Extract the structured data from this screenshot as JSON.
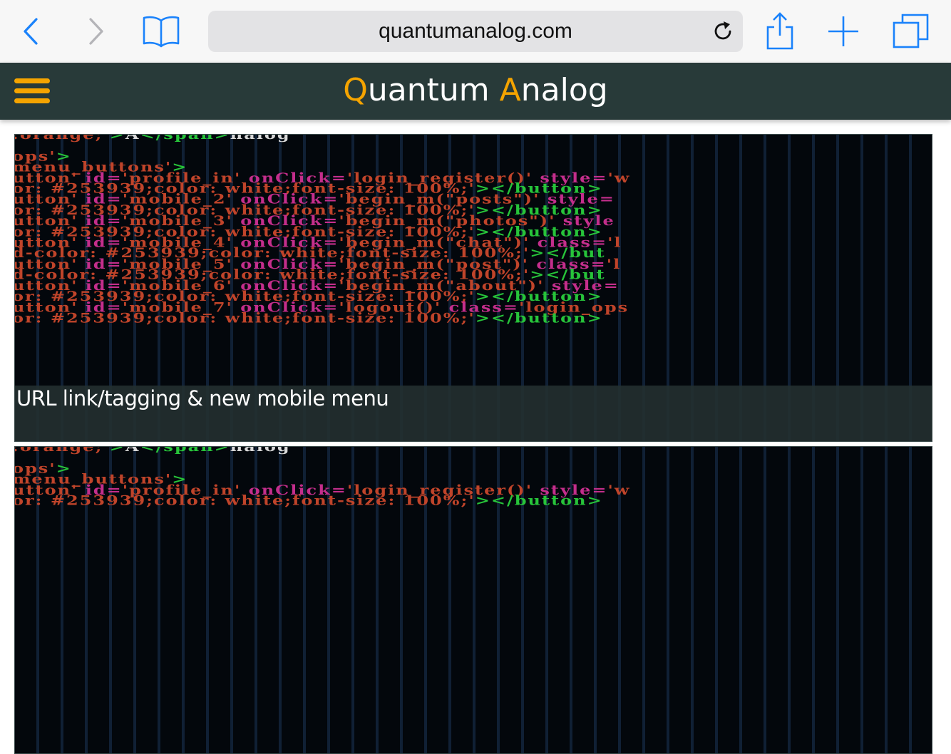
{
  "browser": {
    "url": "quantumanalog.com",
    "icons": {
      "back": "chevron-left-icon",
      "forward": "chevron-right-icon",
      "bookmarks": "book-icon",
      "reload": "reload-icon",
      "share": "share-icon",
      "new_tab": "plus-icon",
      "tabs": "tabs-icon"
    },
    "accent_color": "#1a82fb"
  },
  "site": {
    "title_q": "Q",
    "title_rest1": "uantum ",
    "title_a": "A",
    "title_rest2": "nalog",
    "header_color": "#283a39",
    "accent_color": "#f5a400",
    "menu_icon": "hamburger-icon"
  },
  "posts": [
    {
      "caption": "URL link/tagging & new mobile menu",
      "code_lines": [
        [
          [
            "red",
            ":orange;'"
          ],
          [
            "green",
            ">"
          ],
          [
            "white",
            "A"
          ],
          [
            "green",
            "</span>"
          ],
          [
            "white",
            "nalog"
          ]
        ],
        [
          [
            "red",
            ""
          ]
        ],
        [
          [
            "red",
            "ops'"
          ],
          [
            "green",
            ">"
          ]
        ],
        [
          [
            "red",
            "menu_buttons'"
          ],
          [
            "green",
            ">"
          ]
        ],
        [
          [
            "red",
            "utton' "
          ],
          [
            "pink",
            "id="
          ],
          [
            "red",
            "'profile_in' "
          ],
          [
            "pink",
            "onClick="
          ],
          [
            "red",
            "'login_register()' "
          ],
          [
            "pink",
            "style="
          ],
          [
            "red",
            "'w"
          ]
        ],
        [
          [
            "red",
            "or: #253939;color: "
          ],
          [
            "red",
            "white;font-size: 100%;'"
          ],
          [
            "green",
            "></button>"
          ]
        ],
        [
          [
            "red",
            "utton' "
          ],
          [
            "pink",
            "id="
          ],
          [
            "red",
            "'mobile_2' "
          ],
          [
            "pink",
            "onClick="
          ],
          [
            "red",
            "'begin_m(\"posts\")' "
          ],
          [
            "pink",
            "style="
          ]
        ],
        [
          [
            "red",
            "or: #253939;color: "
          ],
          [
            "red",
            "white;font-size: 100%;'"
          ],
          [
            "green",
            "></button>"
          ]
        ],
        [
          [
            "red",
            "utton' "
          ],
          [
            "pink",
            "id="
          ],
          [
            "red",
            "'mobile_3' "
          ],
          [
            "pink",
            "onClick="
          ],
          [
            "red",
            "'begin_m(\"photos\")' "
          ],
          [
            "pink",
            "style"
          ]
        ],
        [
          [
            "red",
            "or: #253939;color: "
          ],
          [
            "red",
            "white;font-size: 100%;'"
          ],
          [
            "green",
            "></button>"
          ]
        ],
        [
          [
            "red",
            "utton' "
          ],
          [
            "pink",
            "id="
          ],
          [
            "red",
            "'mobile_4' "
          ],
          [
            "pink",
            "onClick="
          ],
          [
            "red",
            "'begin_m(\"chat\")' "
          ],
          [
            "pink",
            "class="
          ],
          [
            "red",
            "'l"
          ]
        ],
        [
          [
            "red",
            "d-color: #253939;color: white;font-size: 100%;'"
          ],
          [
            "green",
            "></but"
          ]
        ],
        [
          [
            "red",
            "utton' "
          ],
          [
            "pink",
            "id="
          ],
          [
            "red",
            "'mobile_5' "
          ],
          [
            "pink",
            "onClick="
          ],
          [
            "red",
            "'begin_m(\"post\")' "
          ],
          [
            "pink",
            "class="
          ],
          [
            "red",
            "'l"
          ]
        ],
        [
          [
            "red",
            "d-color: #253939;color: white;font-size: 100%;'"
          ],
          [
            "green",
            "></but"
          ]
        ],
        [
          [
            "red",
            "utton' "
          ],
          [
            "pink",
            "id="
          ],
          [
            "red",
            "'mobile_6' "
          ],
          [
            "pink",
            "onClick="
          ],
          [
            "red",
            "'begin_m(\"about\")' "
          ],
          [
            "pink",
            "style="
          ]
        ],
        [
          [
            "red",
            "or: #253939;color: "
          ],
          [
            "red",
            "white;font-size: 100%;'"
          ],
          [
            "green",
            "></button>"
          ]
        ],
        [
          [
            "red",
            "utton' "
          ],
          [
            "pink",
            "id="
          ],
          [
            "red",
            "'mobile_7' "
          ],
          [
            "pink",
            "onClick="
          ],
          [
            "red",
            "'logout()' "
          ],
          [
            "pink",
            "class="
          ],
          [
            "red",
            "'login_ops"
          ]
        ],
        [
          [
            "red",
            "or: #253939;color: "
          ],
          [
            "red",
            "white;font-size: 100%;'"
          ],
          [
            "green",
            "></button>"
          ]
        ]
      ]
    },
    {
      "caption": "",
      "code_lines": [
        [
          [
            "red",
            ":orange;'"
          ],
          [
            "green",
            ">"
          ],
          [
            "white",
            "A"
          ],
          [
            "green",
            "</span>"
          ],
          [
            "white",
            "nalog"
          ]
        ],
        [
          [
            "red",
            ""
          ]
        ],
        [
          [
            "red",
            "ops'"
          ],
          [
            "green",
            ">"
          ]
        ],
        [
          [
            "red",
            "menu_buttons'"
          ],
          [
            "green",
            ">"
          ]
        ],
        [
          [
            "red",
            "utton' "
          ],
          [
            "pink",
            "id="
          ],
          [
            "red",
            "'profile_in' "
          ],
          [
            "pink",
            "onClick="
          ],
          [
            "red",
            "'login_register()' "
          ],
          [
            "pink",
            "style="
          ],
          [
            "red",
            "'w"
          ]
        ],
        [
          [
            "red",
            "or: #253939;color: "
          ],
          [
            "red",
            "white;font-size: 100%;'"
          ],
          [
            "green",
            "></button>"
          ]
        ]
      ]
    }
  ]
}
